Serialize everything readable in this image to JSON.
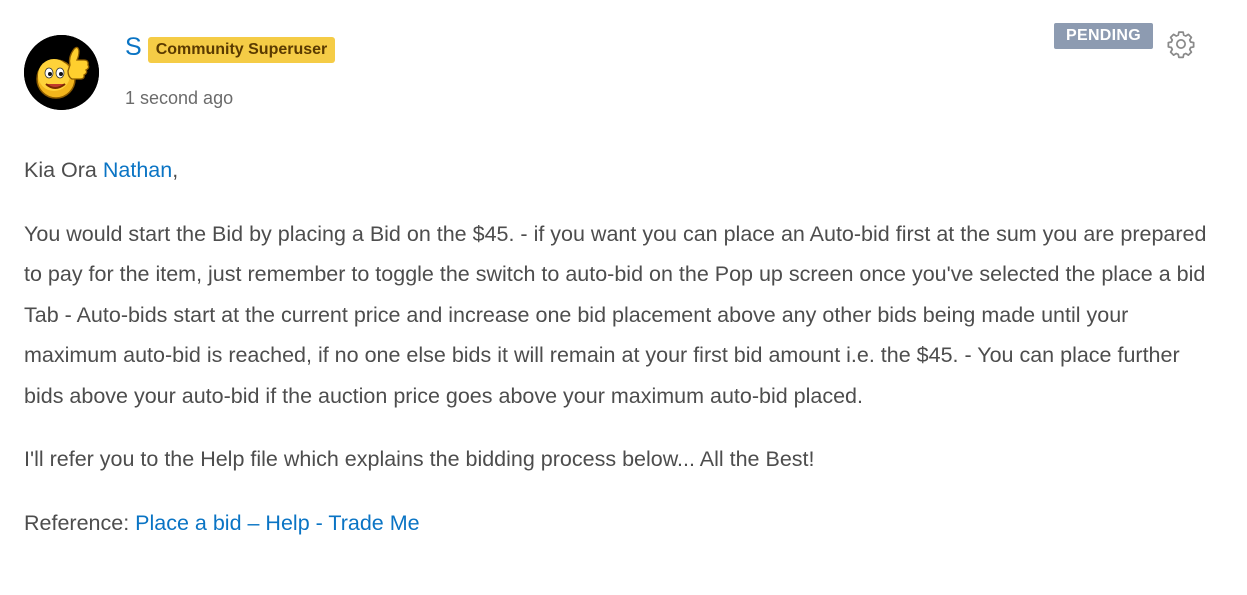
{
  "post": {
    "author": "S",
    "role": "Community Superuser",
    "timestamp": "1 second ago",
    "status": "PENDING",
    "avatar_icon": "thumbs-up-smiley-icon",
    "settings_icon": "gear-icon"
  },
  "body": {
    "greeting_prefix": "Kia Ora ",
    "greeting_mention": "Nathan",
    "greeting_suffix": ",",
    "paragraph1": "You would start the Bid by placing a Bid on the $45. - if you want you can place an Auto-bid first at the sum you are prepared to pay for the item, just remember to toggle the switch to auto-bid on the Pop up screen once you've selected the place a bid Tab - Auto-bids start at the current price and increase one bid placement above any other bids being made until your maximum auto-bid is reached, if no one else bids it will remain at your first bid amount i.e. the $45. - You can place further bids above your auto-bid if the auction price goes above your maximum auto-bid placed.",
    "paragraph2": "I'll refer you to the Help file which explains the bidding process below... All the Best!",
    "reference_label": "Reference: ",
    "reference_link": "Place a bid – Help - Trade Me"
  },
  "colors": {
    "link": "#0a74c4",
    "badge_role": "#f5cc46",
    "badge_status": "#8d9bb1",
    "text": "#4d4d4d"
  }
}
